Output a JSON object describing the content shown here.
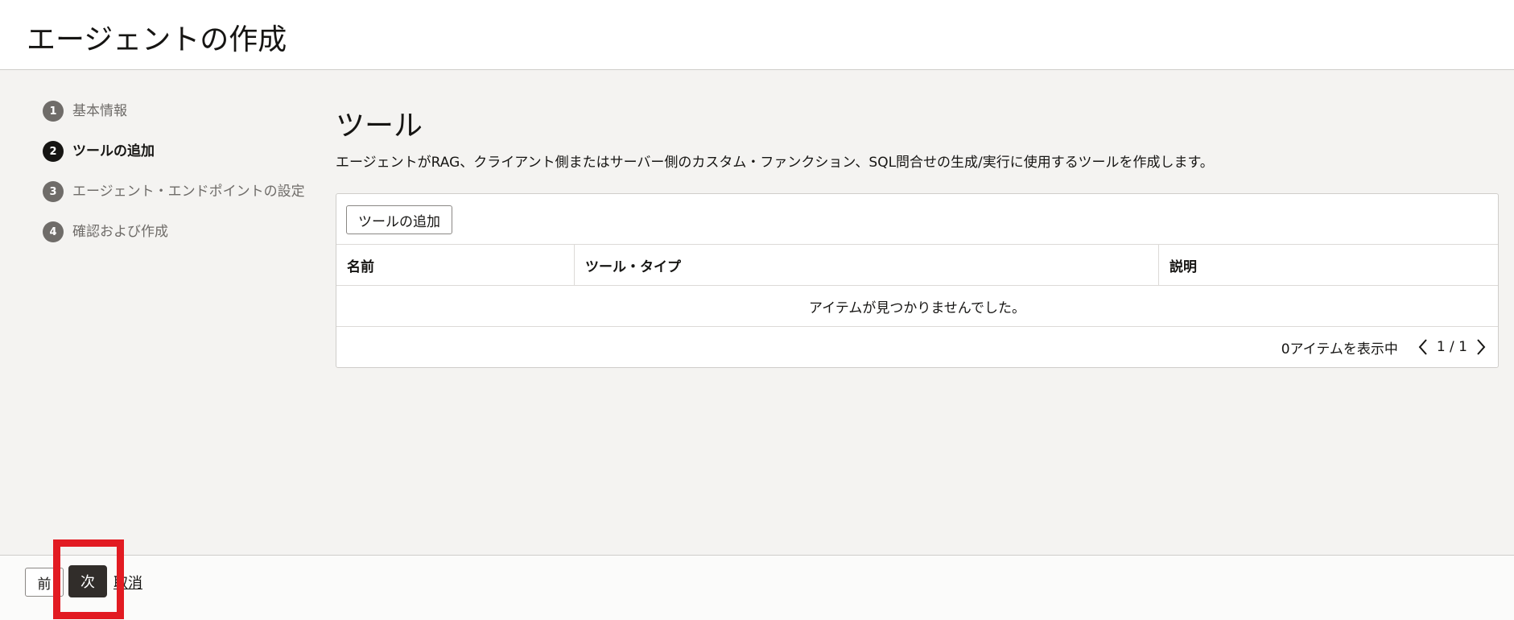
{
  "header": {
    "title": "エージェントの作成"
  },
  "steps": [
    {
      "number": "1",
      "label": "基本情報",
      "active": false
    },
    {
      "number": "2",
      "label": "ツールの追加",
      "active": true
    },
    {
      "number": "3",
      "label": "エージェント・エンドポイントの設定",
      "active": false
    },
    {
      "number": "4",
      "label": "確認および作成",
      "active": false
    }
  ],
  "main": {
    "title": "ツール",
    "description": "エージェントがRAG、クライアント側またはサーバー側のカスタム・ファンクション、SQL問合せの生成/実行に使用するツールを作成します。"
  },
  "table": {
    "add_button_label": "ツールの追加",
    "columns": [
      "名前",
      "ツール・タイプ",
      "説明"
    ],
    "empty_message": "アイテムが見つかりませんでした。",
    "item_count_text": "0アイテムを表示中",
    "page_text": "1 / 1"
  },
  "footer": {
    "prev_label": "前",
    "next_label": "次",
    "cancel_label": "取消"
  },
  "colors": {
    "primary_button": "#312d2a",
    "highlight": "#e21b22",
    "background": "#f4f3f1"
  }
}
